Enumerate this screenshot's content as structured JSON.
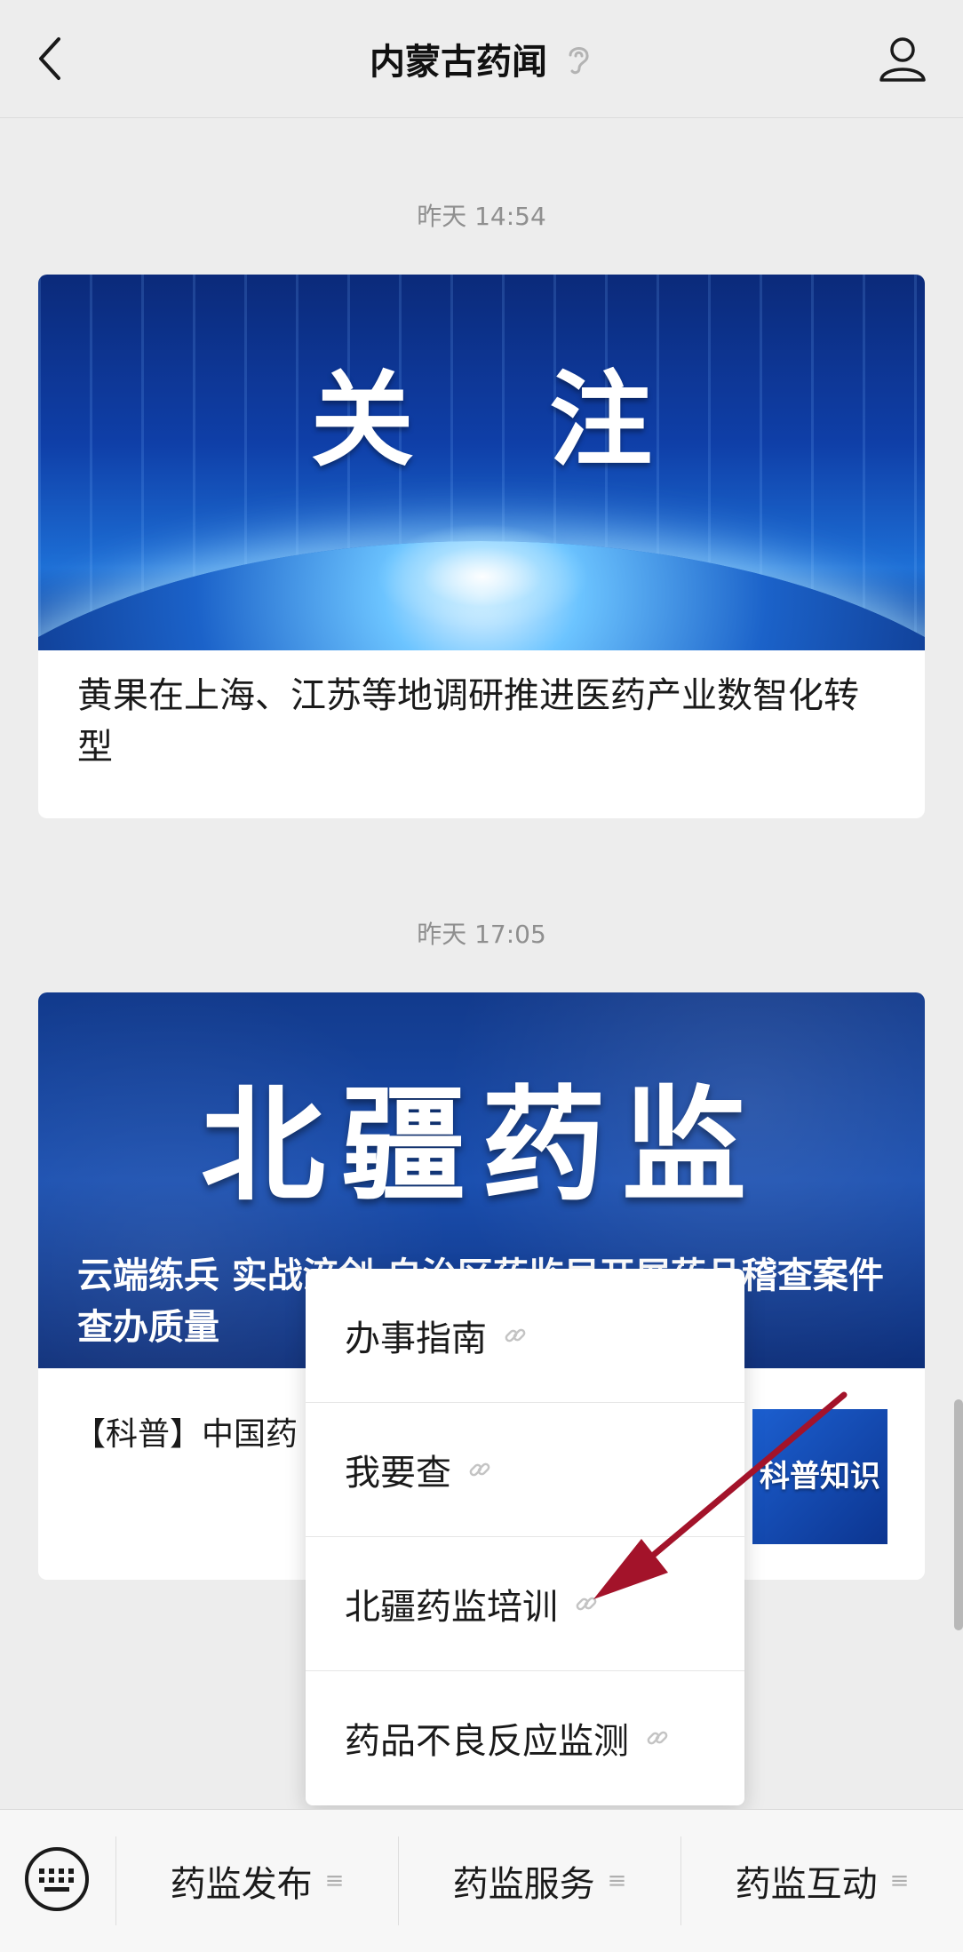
{
  "header": {
    "title": "内蒙古药闻"
  },
  "messages": [
    {
      "timestamp": "昨天 14:54",
      "banner_text": "关 注",
      "title": "黄果在上海、江苏等地调研推进医药产业数智化转型"
    },
    {
      "timestamp": "昨天 17:05",
      "banner_text": "北疆药监",
      "caption": "云端练兵 实战淬剑 自治区药监局开展药品稽查案件查办质量",
      "sub_title": "【科普】中国药 治青少年近视",
      "thumb_text": "科普知识"
    }
  ],
  "popup_menu": {
    "items": [
      {
        "label": "办事指南"
      },
      {
        "label": "我要查"
      },
      {
        "label": "北疆药监培训"
      },
      {
        "label": "药品不良反应监测"
      }
    ]
  },
  "bottom_menu": {
    "tabs": [
      {
        "label": "药监发布",
        "glyph": "≡"
      },
      {
        "label": "药监服务",
        "glyph": "≡"
      },
      {
        "label": "药监互动",
        "glyph": "≡"
      }
    ]
  },
  "colors": {
    "arrow": "#a3132a",
    "header_bg": "#ededed",
    "banner_blue": "#0f3fa8"
  },
  "icons": [
    "back-icon",
    "ear-icon",
    "profile-icon",
    "link-icon",
    "keyboard-icon"
  ]
}
